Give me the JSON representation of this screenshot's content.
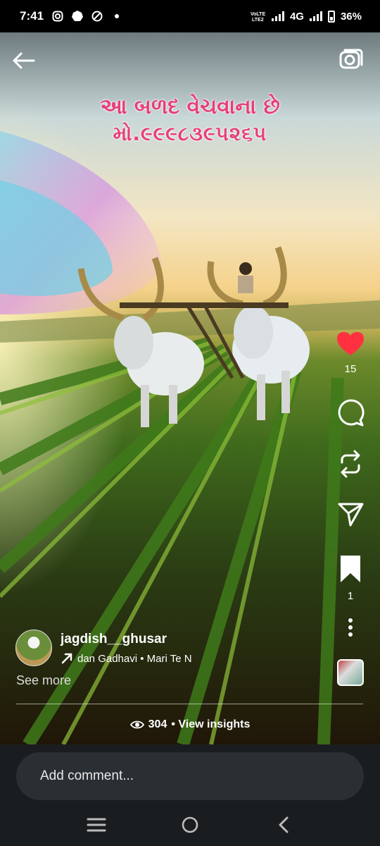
{
  "status": {
    "time": "7:41",
    "network_label": "4G",
    "battery": "36%",
    "icons": [
      "instagram-icon",
      "circle-app-icon",
      "vpn-icon",
      "dot-icon",
      "volte-icon",
      "signal-icon",
      "signal-icon",
      "battery-icon"
    ]
  },
  "video": {
    "overlay_line1": "આ બળદ વેચવાના છે",
    "overlay_line2": "મો.૯૯૯૮૩૯૫૨૬૫"
  },
  "rail": {
    "like_count": "15",
    "save_count": "1",
    "like_color": "#ff3040"
  },
  "author": {
    "username": "jagdish__ghusar",
    "audio_text": "dan Gadhavi • Mari Te N",
    "see_more": "See more"
  },
  "insights": {
    "views": "304",
    "label": "• View insights"
  },
  "comment": {
    "placeholder": "Add comment..."
  }
}
